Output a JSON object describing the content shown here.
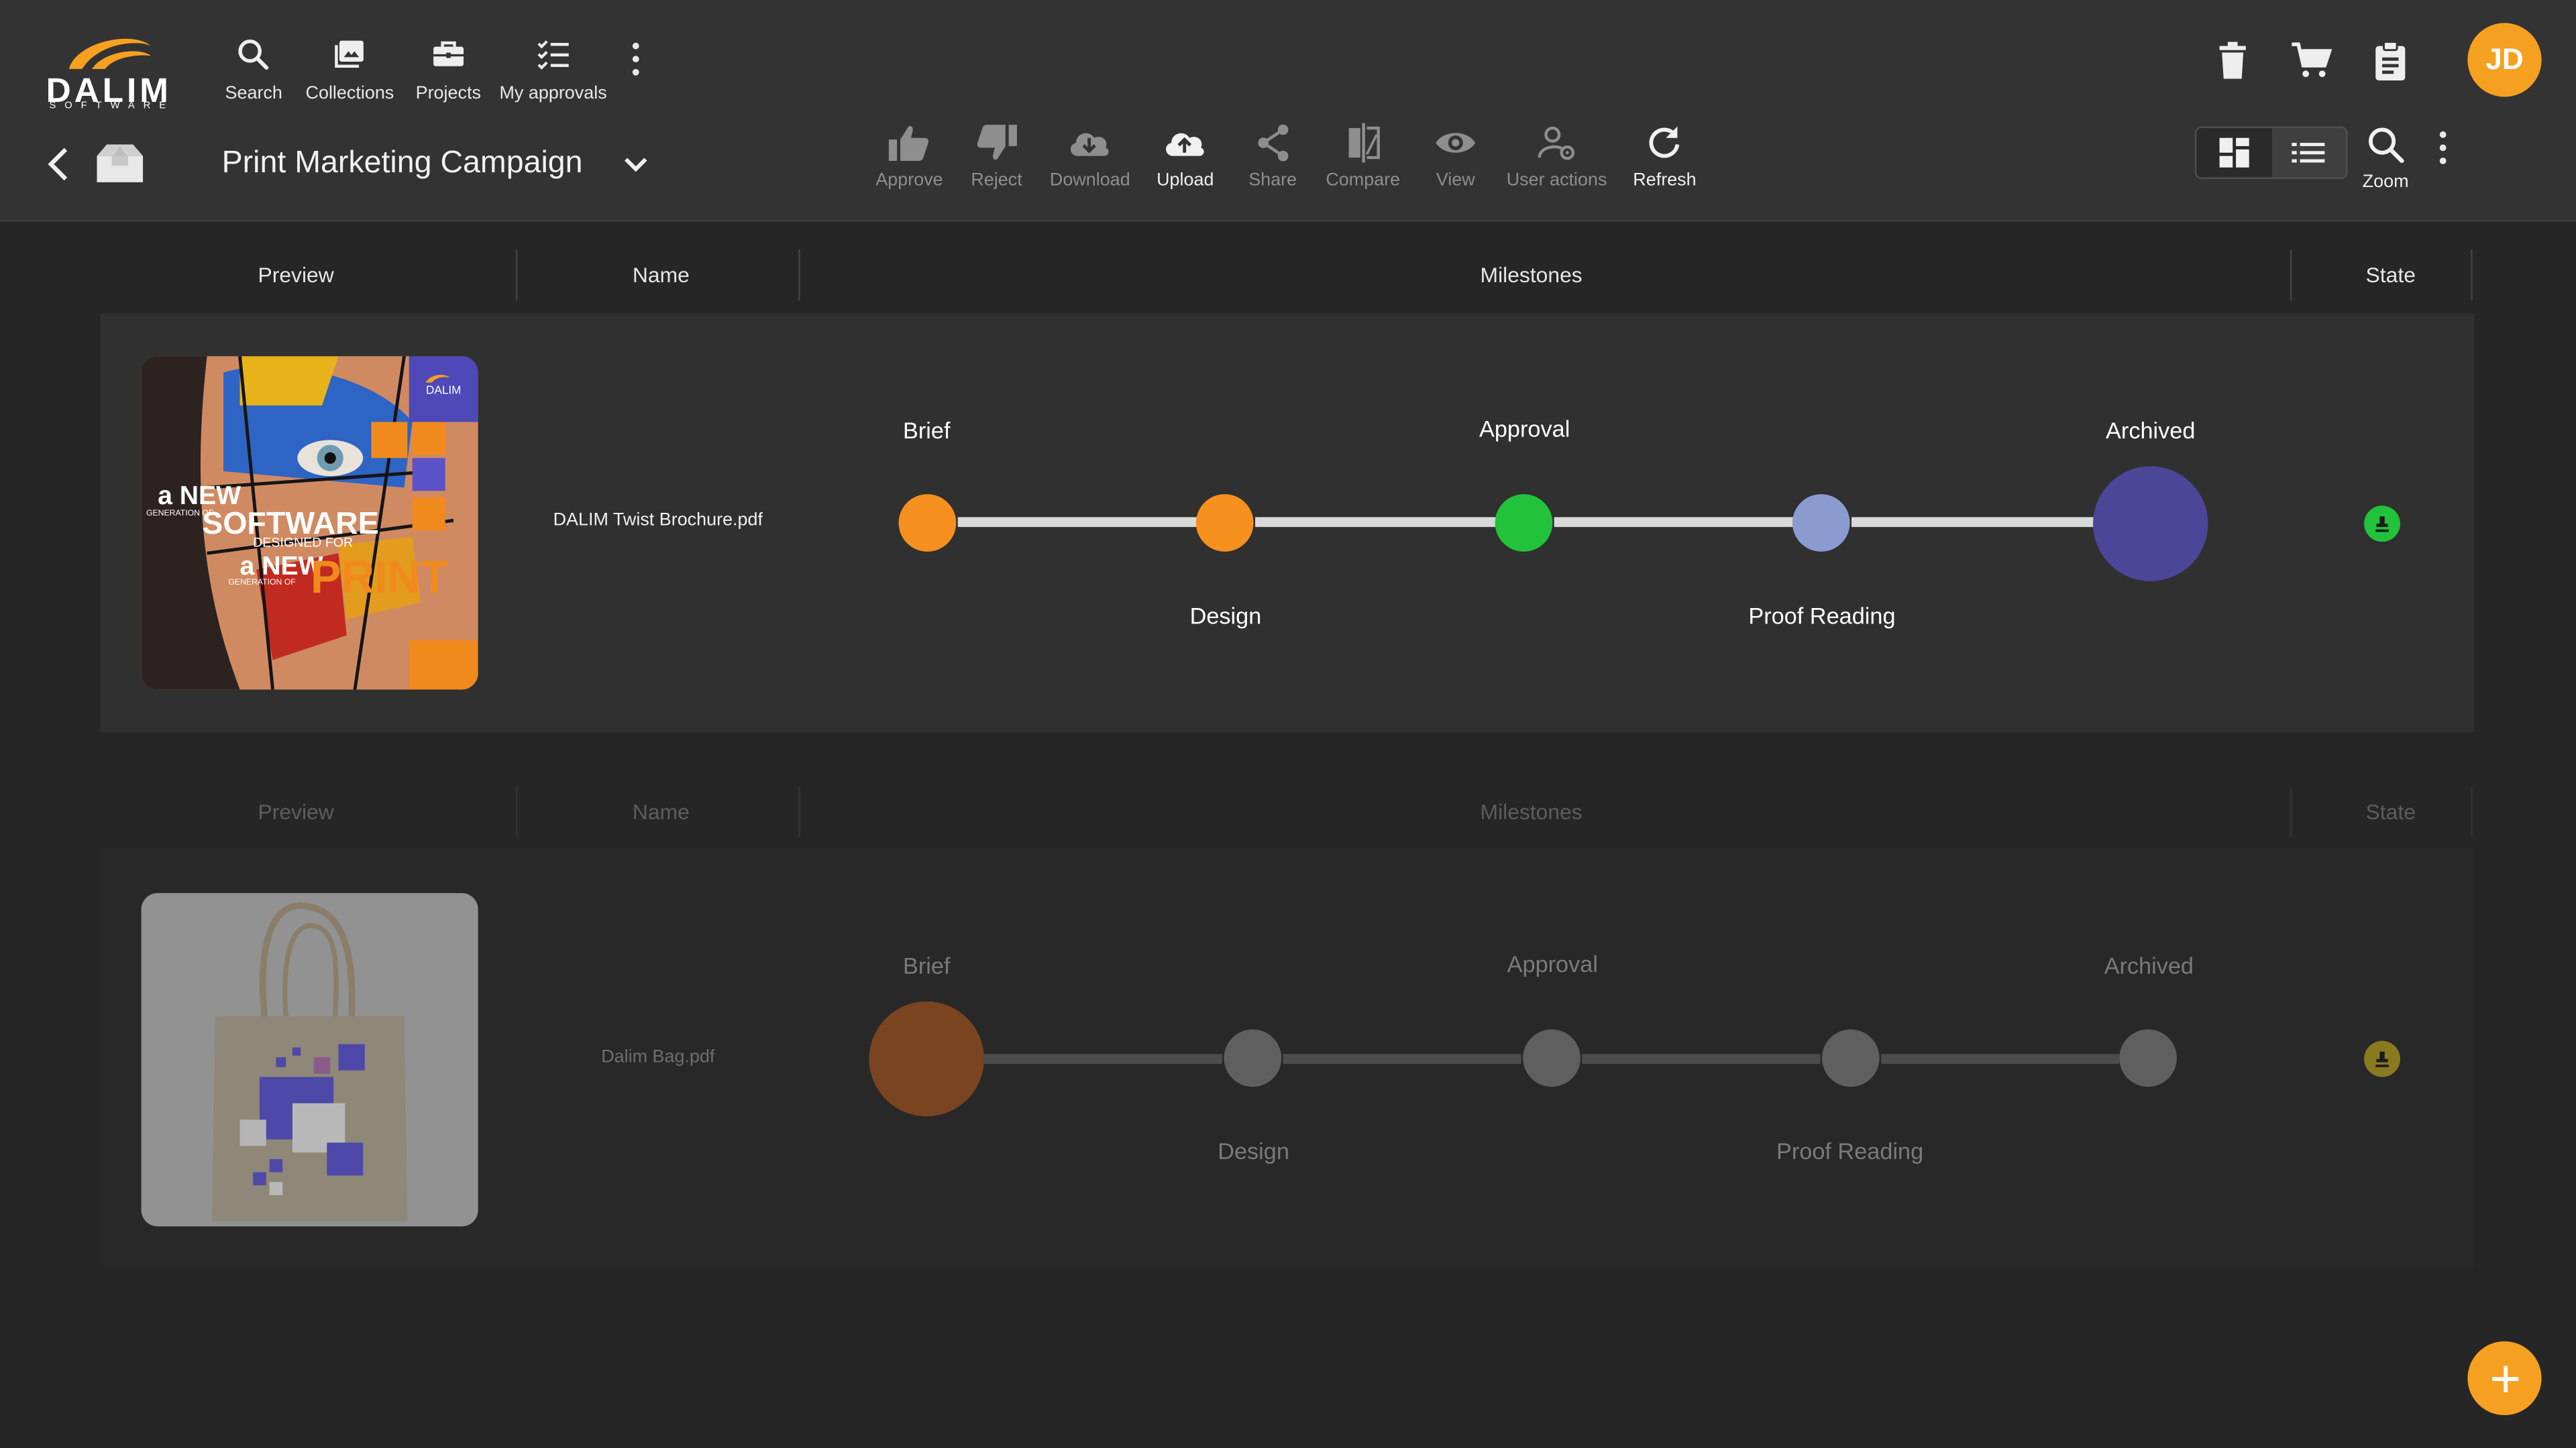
{
  "app": {
    "logo_name": "DALIM",
    "logo_sub": "SOFTWARE",
    "user_initials": "JD",
    "accent_color": "#f6a021"
  },
  "nav": {
    "items": [
      {
        "label": "Search",
        "icon": "search-icon"
      },
      {
        "label": "Collections",
        "icon": "collections-icon"
      },
      {
        "label": "Projects",
        "icon": "briefcase-icon"
      },
      {
        "label": "My approvals",
        "icon": "checklist-icon"
      }
    ]
  },
  "project": {
    "title": "Print Marketing Campaign"
  },
  "toolbar": {
    "items": [
      {
        "label": "Approve",
        "icon": "thumbs-up-icon",
        "enabled": false
      },
      {
        "label": "Reject",
        "icon": "thumbs-down-icon",
        "enabled": false
      },
      {
        "label": "Download",
        "icon": "cloud-download-icon",
        "enabled": false
      },
      {
        "label": "Upload",
        "icon": "cloud-upload-icon",
        "enabled": true
      },
      {
        "label": "Share",
        "icon": "share-icon",
        "enabled": false
      },
      {
        "label": "Compare",
        "icon": "compare-icon",
        "enabled": false
      },
      {
        "label": "View",
        "icon": "eye-icon",
        "enabled": false
      },
      {
        "label": "User actions",
        "icon": "user-gear-icon",
        "enabled": false
      },
      {
        "label": "Refresh",
        "icon": "refresh-icon",
        "enabled": true
      }
    ],
    "zoom_label": "Zoom"
  },
  "table": {
    "columns": [
      "Preview",
      "Name",
      "Milestones",
      "State"
    ],
    "rows": [
      {
        "name": "DALIM Twist Brochure.pdf",
        "thumbnail_text": {
          "line1": "a NEW",
          "tag1": "GENERATION OF",
          "line2": "SOFTWARE",
          "tag2": "DESIGNED FOR",
          "line3": "a NEW",
          "tag3": "GENERATION OF",
          "line4": "PRINT",
          "brand": "DALIM"
        },
        "milestones": [
          {
            "label": "Brief",
            "status": "done",
            "color": "#f6901e"
          },
          {
            "label": "Design",
            "status": "done",
            "color": "#f6901e"
          },
          {
            "label": "Approval",
            "status": "approved",
            "color": "#22c33b"
          },
          {
            "label": "Proof Reading",
            "status": "pending",
            "color": "#8b9bd0"
          },
          {
            "label": "Archived",
            "status": "current",
            "color": "#4c4699"
          }
        ],
        "state_color": "#22c33b",
        "state_icon": "stamp-icon"
      },
      {
        "name": "Dalim Bag.pdf",
        "milestones": [
          {
            "label": "Brief",
            "status": "current",
            "color": "#7a4420"
          },
          {
            "label": "Design",
            "status": "inactive",
            "color": "#5f5f5f"
          },
          {
            "label": "Approval",
            "status": "inactive",
            "color": "#5f5f5f"
          },
          {
            "label": "Proof Reading",
            "status": "inactive",
            "color": "#5f5f5f"
          },
          {
            "label": "Archived",
            "status": "inactive",
            "color": "#5f5f5f"
          }
        ],
        "state_color": "#8a7a1f",
        "state_icon": "stamp-icon"
      }
    ]
  }
}
